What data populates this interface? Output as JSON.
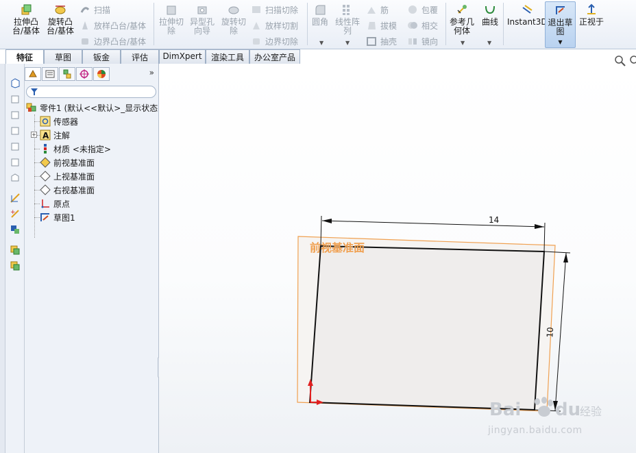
{
  "ribbon": {
    "extrude_boss": "拉伸凸\n台/基体",
    "revolve_boss": "旋转凸\n台/基体",
    "sweep": "扫描",
    "loft_boss": "放样凸台/基体",
    "boundary_boss": "边界凸台/基体",
    "extrude_cut": "拉伸切\n除",
    "hole_wizard": "异型孔\n向导",
    "revolve_cut": "旋转切\n除",
    "sweep_cut": "扫描切除",
    "loft_cut": "放样切割",
    "boundary_cut": "边界切除",
    "fillet": "圆角",
    "linear_pattern": "线性阵\n列",
    "rib": "筋",
    "draft": "拔模",
    "shell": "抽壳",
    "wrap": "包覆",
    "intersect": "相交",
    "mirror": "镜向",
    "reference_geometry": "参考几\n何体",
    "curves": "曲线",
    "instant3d": "Instant3D",
    "exit_sketch": "退出草\n图",
    "normal_to": "正视于"
  },
  "tabs": [
    "特征",
    "草图",
    "钣金",
    "评估",
    "DimXpert",
    "渲染工具",
    "办公室产品"
  ],
  "tree": {
    "root": "零件1 (默认<<默认>_显示状态",
    "items": [
      "传感器",
      "注解",
      "材质 <未指定>",
      "前视基准面",
      "上视基准面",
      "右视基准面",
      "原点",
      "草图1"
    ]
  },
  "panel_more": "»",
  "sketch": {
    "plane_label": "前视基准面",
    "dim_width": "14",
    "dim_height": "10"
  },
  "watermark": {
    "logo": "Bai du 经验",
    "url": "jingyan.baidu.com"
  },
  "colors": {
    "plane_orange": "#f0a050",
    "plane_label": "#f0a050",
    "sketch_line": "#111111",
    "origin_red": "#e02020"
  }
}
